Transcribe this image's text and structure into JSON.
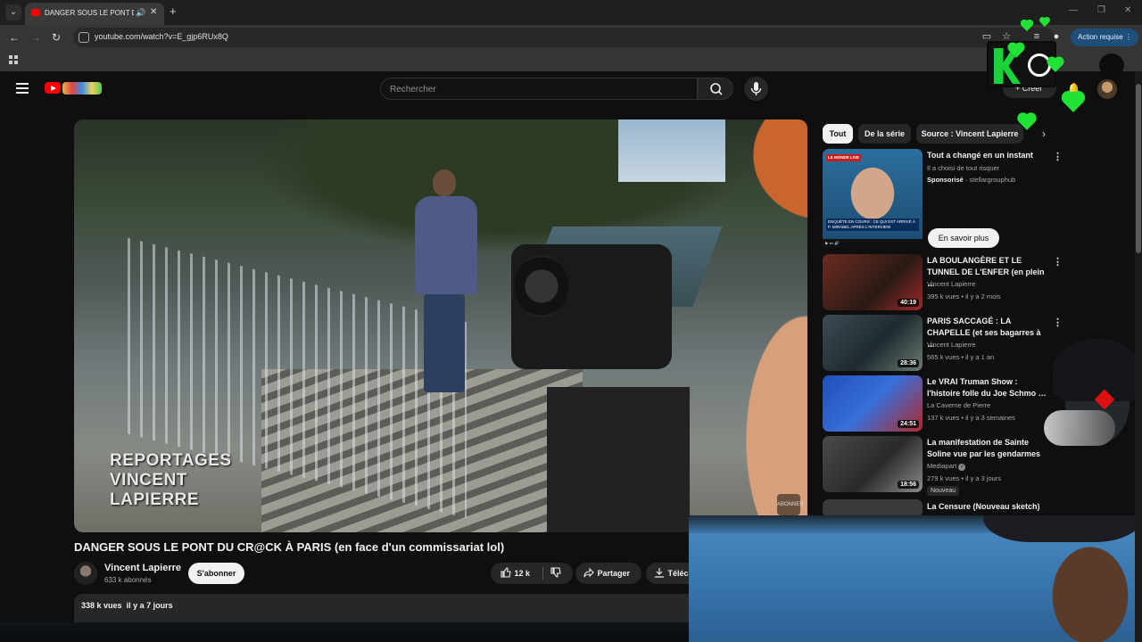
{
  "browser": {
    "tab_title": "DANGER SOUS LE PONT DU CR@CK",
    "url": "youtube.com/watch?v=E_gjp6RUx8Q",
    "action_button": "Action requise"
  },
  "masthead": {
    "search_placeholder": "Rechercher",
    "create_label": "Créer"
  },
  "player": {
    "watermark_line1": "REPORTAGES",
    "watermark_line2": "VINCENT LAPIERRE",
    "subscribe_badge": "ABONNER"
  },
  "video": {
    "title": "DANGER SOUS LE PONT DU CR@CK À PARIS (en face d'un commissariat lol)",
    "channel": "Vincent Lapierre",
    "subscribers": "633 k abonnés",
    "subscribe_label": "S'abonner",
    "likes": "12 k",
    "share_label": "Partager",
    "download_label": "Téléc",
    "views": "338 k vues",
    "age": "il y a 7 jours"
  },
  "chips": [
    "Tout",
    "De la série",
    "Source : Vincent Lapierre"
  ],
  "ad": {
    "title": "Tout a changé en un instant",
    "description": "Il a choisi de tout risquer",
    "sponsored": "Sponsorisé",
    "advertiser": "stellargrouphub",
    "cta": "En savoir plus",
    "thumb_badge": "LE MONDE LIVE",
    "thumb_caption": "ENQUÊTE EN COURS : CE QUI EST ARRIVÉ À P. MIRABEL APRÈS L'INTERVIEW"
  },
  "recommendations": [
    {
      "title": "LA BOULANGÈRE ET LE TUNNEL DE L'ENFER (en plein …",
      "channel": "Vincent Lapierre",
      "meta": "395 k vues • il y a 2 mois",
      "duration": "40:19",
      "color": "#7a2a2a"
    },
    {
      "title": "PARIS SACCAGÉ : LA CHAPELLE (et ses bagarres à …",
      "channel": "Vincent Lapierre",
      "meta": "565 k vues • il y a 1 an",
      "duration": "28:36",
      "color": "#3b4a52"
    },
    {
      "title": "Le VRAI Truman Show : l'histoire folle du Joe Schmo …",
      "channel": "La Caverne de Pierre",
      "meta": "137 k vues • il y a 3 semaines",
      "duration": "24:51",
      "color": "#2a55b8"
    },
    {
      "title": "La manifestation de Sainte Soline vue par les gendarmes",
      "channel": "Mediapart",
      "meta": "279 k vues • il y a 3 jours",
      "duration": "18:56",
      "color": "#5a5a5a",
      "badge": "Nouveau"
    },
    {
      "title": "La Censure (Nouveau sketch)",
      "channel": "",
      "meta": "",
      "duration": "",
      "color": "#444"
    }
  ]
}
